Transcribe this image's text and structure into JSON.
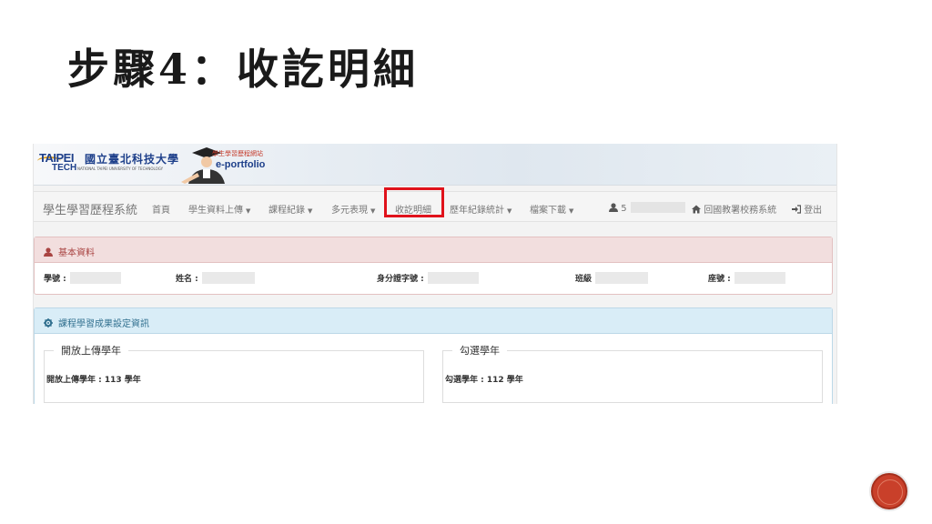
{
  "slide": {
    "title": "步驟4：收訖明細"
  },
  "banner": {
    "logo_taipei": "TAIPEI",
    "logo_tech": "TECH",
    "logo_cn": "國立臺北科技大學",
    "logo_en": "NATIONAL TAIPEI UNIVERSITY OF TECHNOLOGY",
    "portal_small": "學生學習歷程網站",
    "portal_main": "e-portfolio"
  },
  "navbar": {
    "brand": "學生學習歷程系統",
    "items": [
      {
        "label": "首頁",
        "caret": false
      },
      {
        "label": "學生資料上傳",
        "caret": true
      },
      {
        "label": "課程紀錄",
        "caret": true
      },
      {
        "label": "多元表現",
        "caret": true
      },
      {
        "label": "收訖明細",
        "caret": false
      },
      {
        "label": "歷年紀錄統計",
        "caret": true
      },
      {
        "label": "檔案下載",
        "caret": true
      }
    ],
    "user_prefix": "5",
    "home_label": "回國教署校務系統",
    "logout_label": "登出",
    "caret_glyph": "▼"
  },
  "basic_info": {
    "title": "基本資料",
    "student_id_label": "學號 :",
    "name_label": "姓名 :",
    "national_id_label": "身分證字號 :",
    "class_label": "班級",
    "seat_label": "座號 :"
  },
  "course_settings": {
    "title": "課程學習成果設定資訊",
    "upload_box": {
      "legend": "開放上傳學年",
      "text": "開放上傳學年 : 113  學年"
    },
    "select_box": {
      "legend": "勾選學年",
      "text": "勾選學年 : 112  學年"
    }
  },
  "colors": {
    "highlight": "#e0121b",
    "danger_panel": "#f2dede",
    "info_panel": "#d9edf7",
    "badge": "#c9402a"
  }
}
